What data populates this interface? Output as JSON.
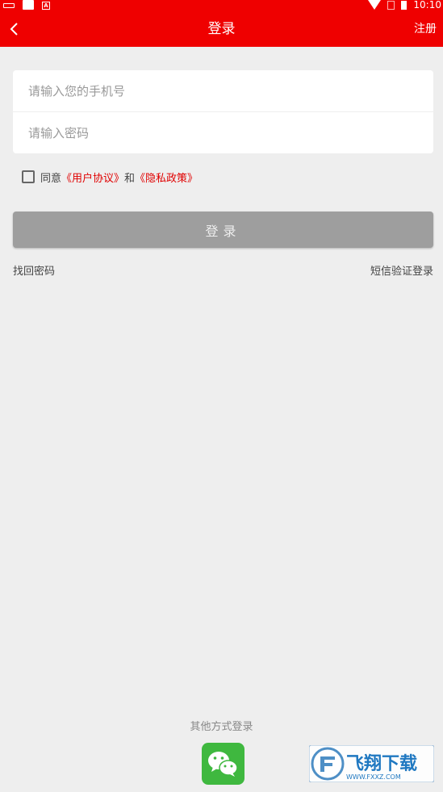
{
  "status_bar": {
    "time": "10:10",
    "a_badge": "A"
  },
  "nav": {
    "title": "登录",
    "register_label": "注册"
  },
  "form": {
    "phone_placeholder": "请输入您的手机号",
    "password_placeholder": "请输入密码",
    "agreement": {
      "prefix": "同意",
      "user_agreement": "《用户协议》",
      "and": "和",
      "privacy_policy": "《隐私政策》"
    },
    "login_label": "登录",
    "forgot_password": "找回密码",
    "sms_login": "短信验证登录"
  },
  "other_login": {
    "label": "其他方式登录",
    "options": [
      "wechat-icon"
    ]
  },
  "watermark": {
    "text_cn": "飞翔下载",
    "text_en": "WWW.FXXZ.COM"
  },
  "colors": {
    "brand_red": "#ef0000",
    "button_gray": "#9e9e9e",
    "wechat_green": "#3fb83f",
    "background": "#eeeeee"
  }
}
